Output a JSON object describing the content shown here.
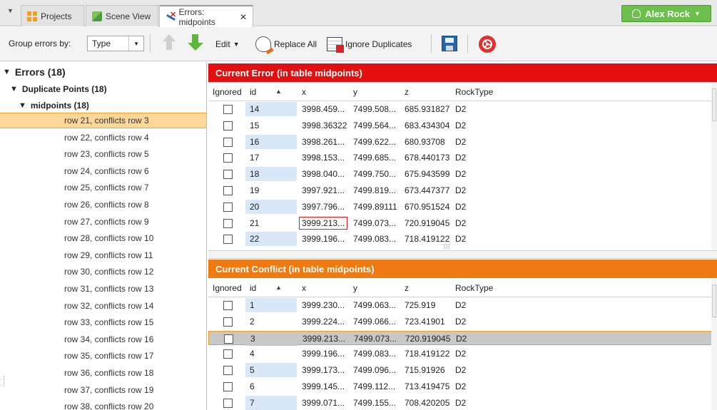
{
  "tabs": [
    {
      "label": "Projects",
      "icon": "projects-icon"
    },
    {
      "label": "Scene View",
      "icon": "scene-view-icon"
    },
    {
      "label": "Errors: midpoints",
      "icon": "errors-icon",
      "active": true
    }
  ],
  "user": {
    "name": "Alex Rock"
  },
  "toolbar": {
    "group_label": "Group errors by:",
    "group_value": "Type",
    "edit_label": "Edit",
    "replace_all_label": "Replace All",
    "ignore_duplicates_label": "Ignore Duplicates"
  },
  "tree": {
    "root": "Errors (18)",
    "group": "Duplicate Points (18)",
    "table": "midpoints (18)",
    "items": [
      "row 21, conflicts row 3",
      "row 22, conflicts row 4",
      "row 23, conflicts row 5",
      "row 24, conflicts row 6",
      "row 25, conflicts row 7",
      "row 26, conflicts row 8",
      "row 27, conflicts row 9",
      "row 28, conflicts row 10",
      "row 29, conflicts row 11",
      "row 30, conflicts row 12",
      "row 31, conflicts row 13",
      "row 32, conflicts row 14",
      "row 33, conflicts row 15",
      "row 34, conflicts row 16",
      "row 35, conflicts row 17",
      "row 36, conflicts row 18",
      "row 37, conflicts row 19",
      "row 38, conflicts row 20"
    ],
    "selected_index": 0
  },
  "current_error": {
    "title": "Current Error (in table midpoints)",
    "columns": [
      "Ignored",
      "id",
      "x",
      "y",
      "z",
      "RockType"
    ],
    "rows": [
      [
        "14",
        "3998.459...",
        "7499.508...",
        "685.931827",
        "D2"
      ],
      [
        "15",
        "3998.36322",
        "7499.564...",
        "683.434304",
        "D2"
      ],
      [
        "16",
        "3998.261...",
        "7499.622...",
        "680.93708",
        "D2"
      ],
      [
        "17",
        "3998.153...",
        "7499.685...",
        "678.440173",
        "D2"
      ],
      [
        "18",
        "3998.040...",
        "7499.750...",
        "675.943599",
        "D2"
      ],
      [
        "19",
        "3997.921...",
        "7499.819...",
        "673.447377",
        "D2"
      ],
      [
        "20",
        "3997.796...",
        "7499.89111",
        "670.951524",
        "D2"
      ],
      [
        "21",
        "3999.213...",
        "7499.073...",
        "720.919045",
        "D2"
      ],
      [
        "22",
        "3999.196...",
        "7499.083...",
        "718.419122",
        "D2"
      ]
    ],
    "error_row_index": 7
  },
  "current_conflict": {
    "title": "Current Conflict (in table midpoints)",
    "columns": [
      "Ignored",
      "id",
      "x",
      "y",
      "z",
      "RockType"
    ],
    "rows": [
      [
        "1",
        "3999.230...",
        "7499.063...",
        "725.919",
        "D2"
      ],
      [
        "2",
        "3999.224...",
        "7499.066...",
        "723.41901",
        "D2"
      ],
      [
        "3",
        "3999.213...",
        "7499.073...",
        "720.919045",
        "D2"
      ],
      [
        "4",
        "3999.196...",
        "7499.083...",
        "718.419122",
        "D2"
      ],
      [
        "5",
        "3999.173...",
        "7499.096...",
        "715.91926",
        "D2"
      ],
      [
        "6",
        "3999.145...",
        "7499.112...",
        "713.419475",
        "D2"
      ],
      [
        "7",
        "3999.071...",
        "7499.155...",
        "708.420205",
        "D2"
      ]
    ],
    "selected_index": 2
  },
  "colors": {
    "error_header": "#e21010",
    "conflict_header": "#f07a12",
    "user_button": "#6bbf4a",
    "selection": "#fbd79b"
  }
}
